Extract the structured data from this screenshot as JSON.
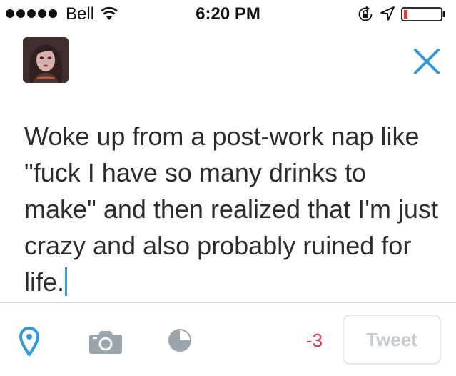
{
  "status_bar": {
    "signal_bars": 5,
    "carrier": "Bell",
    "time": "6:20 PM",
    "icons": [
      "wifi-icon",
      "rotation-lock-icon",
      "location-arrow-icon",
      "battery-icon"
    ],
    "battery_level_fraction": 0.1,
    "battery_color": "#e03a3a"
  },
  "header": {
    "avatar": "avatar",
    "close_icon": "close-icon",
    "accent_color": "#2d98e3"
  },
  "compose": {
    "text": "Woke up from a post-work nap like \"fuck I have so many drinks to make\" and then realized that I'm just crazy and also probably ruined for life.",
    "caret_color": "#3a97e0"
  },
  "toolbar": {
    "icons": [
      "location-pin-icon",
      "camera-icon",
      "poll-icon"
    ],
    "char_count": "-3",
    "char_count_color": "#d6304f",
    "tweet_label": "Tweet",
    "tweet_enabled": false
  }
}
